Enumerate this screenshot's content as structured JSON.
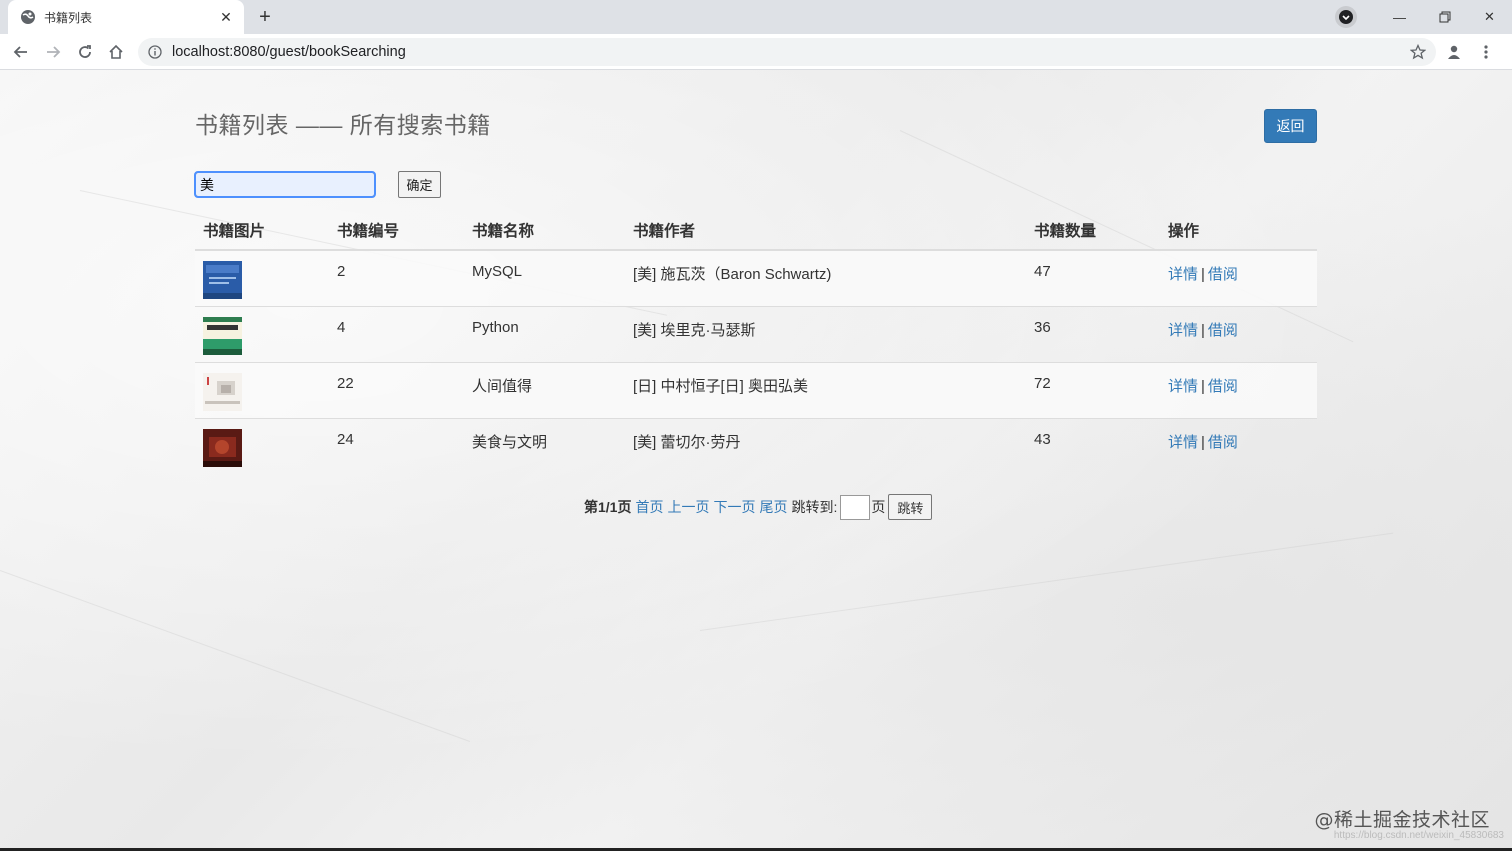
{
  "browser": {
    "tab_title": "书籍列表",
    "url": "localhost:8080/guest/bookSearching"
  },
  "page": {
    "title": "书籍列表 —— 所有搜索书籍",
    "back_label": "返回",
    "search": {
      "value": "美",
      "placeholder": ""
    },
    "confirm_label": "确定",
    "columns": [
      "书籍图片",
      "书籍编号",
      "书籍名称",
      "书籍作者",
      "书籍数量",
      "操作"
    ],
    "rows": [
      {
        "id": "2",
        "name": "MySQL",
        "author": "[美] 施瓦茨（Baron Schwartz)",
        "count": "47",
        "detail": "详情",
        "borrow": "借阅",
        "cover": "mysql-cover"
      },
      {
        "id": "4",
        "name": "Python",
        "author": "[美] 埃里克·马瑟斯",
        "count": "36",
        "detail": "详情",
        "borrow": "借阅",
        "cover": "python-cover"
      },
      {
        "id": "22",
        "name": "人间值得",
        "author": "[日] 中村恒子[日] 奥田弘美",
        "count": "72",
        "detail": "详情",
        "borrow": "借阅",
        "cover": "renjian-cover"
      },
      {
        "id": "24",
        "name": "美食与文明",
        "author": "[美] 蕾切尔·劳丹",
        "count": "43",
        "detail": "详情",
        "borrow": "借阅",
        "cover": "food-cover"
      }
    ],
    "separator": "|",
    "pager": {
      "current": "第1/1页",
      "first": "首页",
      "prev": "上一页",
      "next": "下一页",
      "last": "尾页",
      "jump_label": "跳转到:",
      "page_unit": "页",
      "go_label": "跳转"
    }
  },
  "watermark": {
    "main": "@稀土掘金技术社区",
    "sub": "https://blog.csdn.net/weixin_45830683"
  }
}
